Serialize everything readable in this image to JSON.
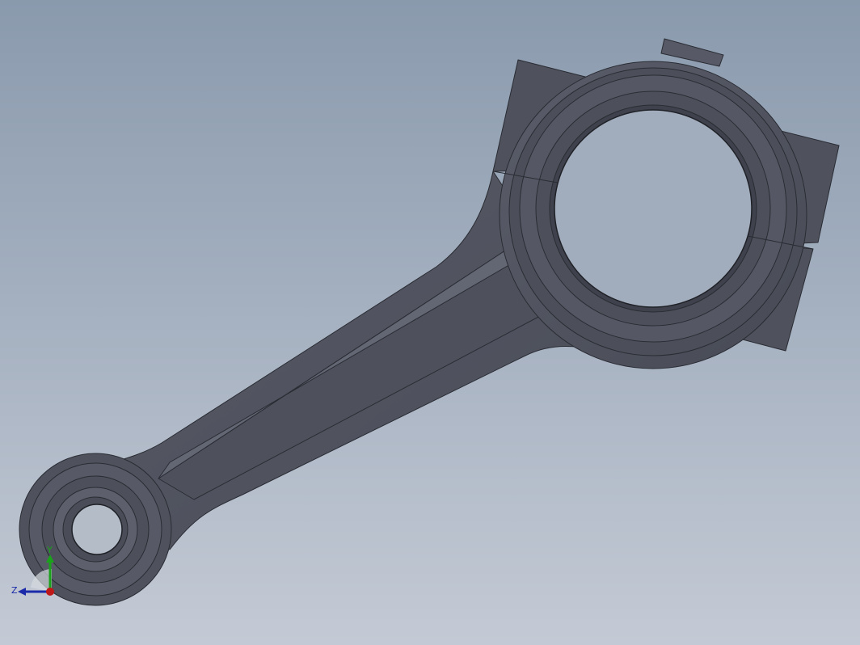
{
  "viewport": {
    "background_top": "#8a9aad",
    "background_bottom": "#c4cad5",
    "part_color": "#50535f",
    "part_edge_color": "#2a2c33",
    "part_highlight_color": "#6c7080"
  },
  "triad": {
    "y_label": "Y",
    "z_label": "Z",
    "y_color": "#1aa31a",
    "z_color": "#1a2aa8",
    "x_color": "#c01818"
  }
}
